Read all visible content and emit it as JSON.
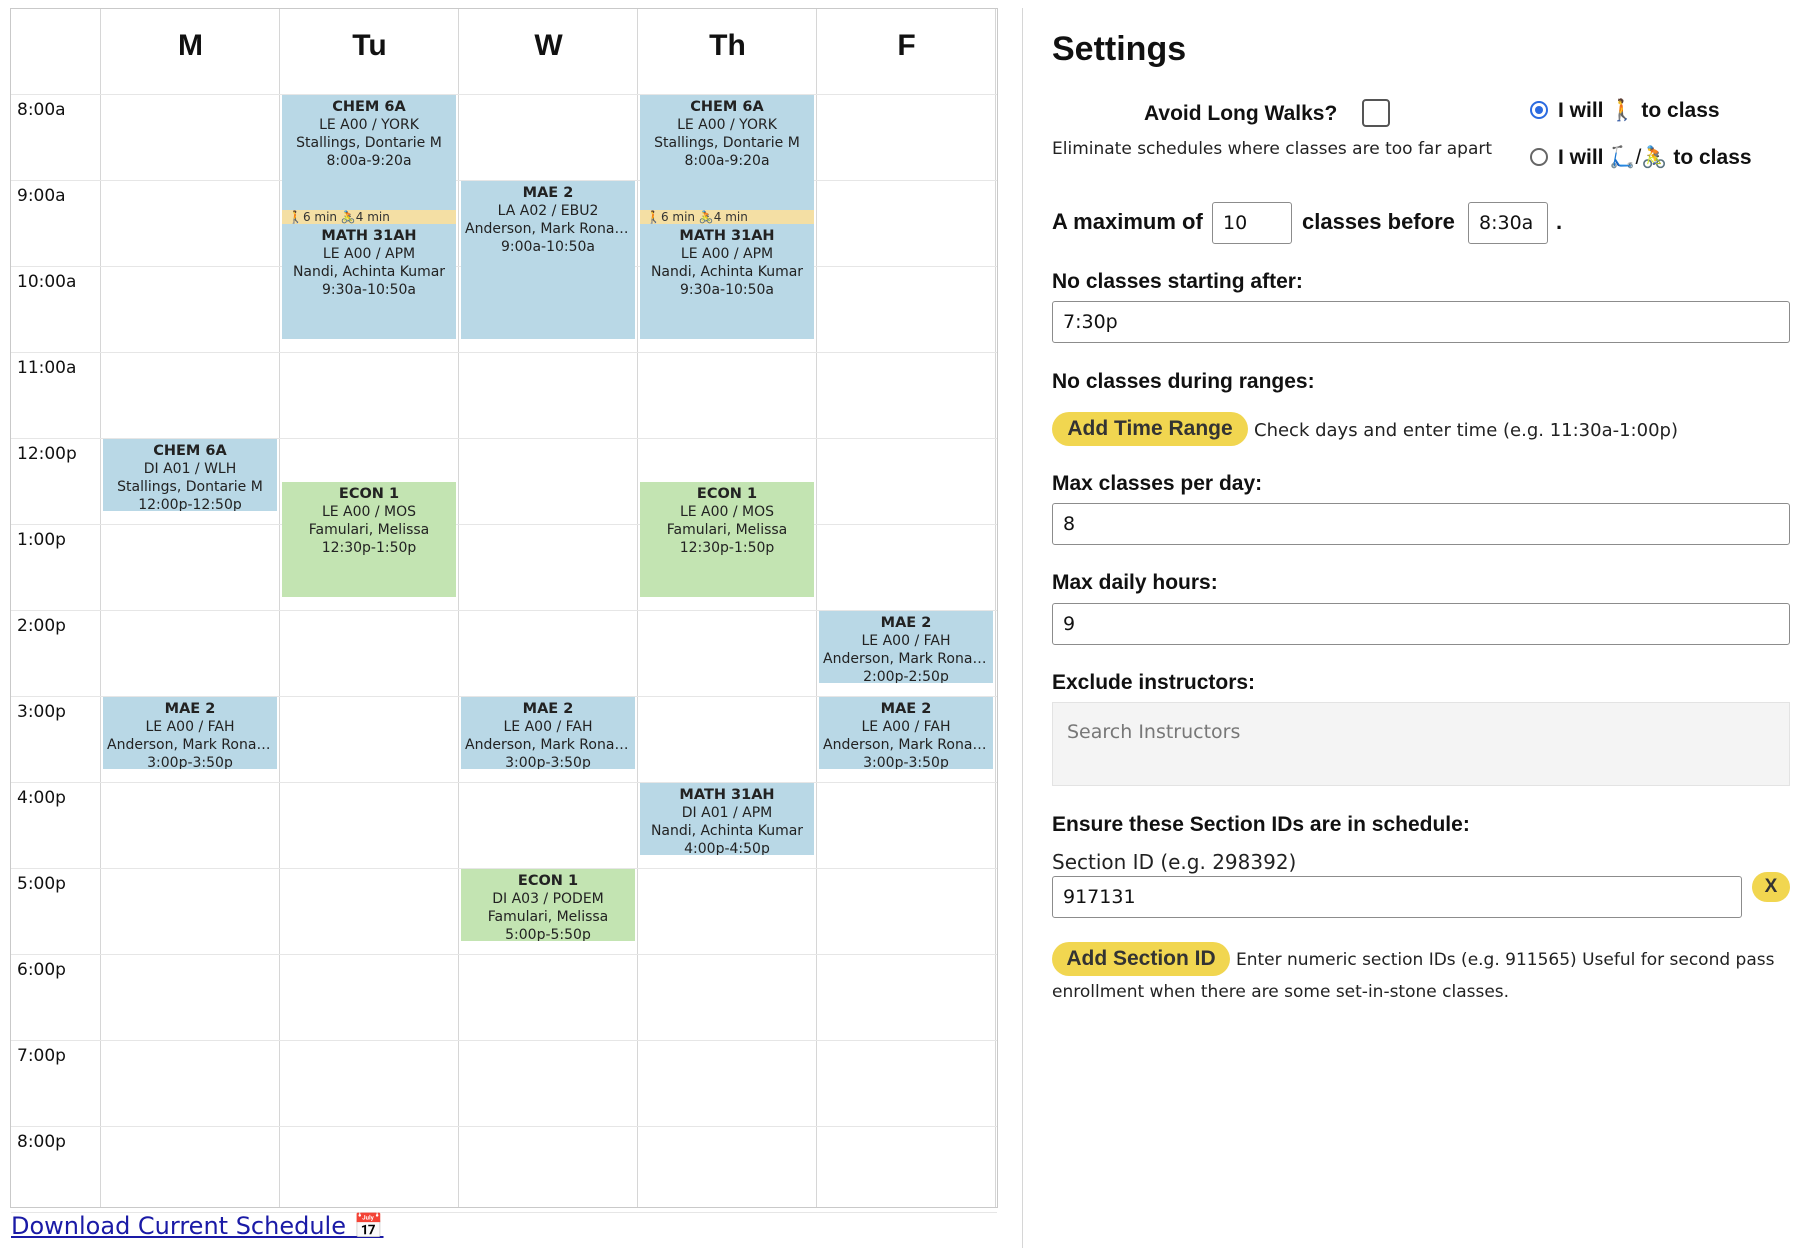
{
  "calendar": {
    "days": [
      "M",
      "Tu",
      "W",
      "Th",
      "F"
    ],
    "times": [
      "8:00a",
      "9:00a",
      "10:00a",
      "11:00a",
      "12:00p",
      "1:00p",
      "2:00p",
      "3:00p",
      "4:00p",
      "5:00p",
      "6:00p",
      "7:00p",
      "8:00p"
    ],
    "events": [
      {
        "day": 1,
        "start": 0,
        "end": 1.34,
        "color": "blue",
        "title": "CHEM 6A",
        "section": "LE A00 / YORK",
        "instructor": "Stallings, Dontarie M",
        "time": "8:00a-9:20a"
      },
      {
        "day": 1,
        "start": 1.5,
        "end": 2.84,
        "color": "blue",
        "title": "MATH 31AH",
        "section": "LE A00 / APM",
        "instructor": "Nandi, Achinta Kumar",
        "time": "9:30a-10:50a"
      },
      {
        "day": 3,
        "start": 0,
        "end": 1.34,
        "color": "blue",
        "title": "CHEM 6A",
        "section": "LE A00 / YORK",
        "instructor": "Stallings, Dontarie M",
        "time": "8:00a-9:20a"
      },
      {
        "day": 3,
        "start": 1.5,
        "end": 2.84,
        "color": "blue",
        "title": "MATH 31AH",
        "section": "LE A00 / APM",
        "instructor": "Nandi, Achinta Kumar",
        "time": "9:30a-10:50a"
      },
      {
        "day": 2,
        "start": 1,
        "end": 2.84,
        "color": "blue",
        "title": "MAE 2",
        "section": "LA A02 / EBU2",
        "instructor": "Anderson, Mark Ronal...",
        "time": "9:00a-10:50a"
      },
      {
        "day": 0,
        "start": 4,
        "end": 4.84,
        "color": "blue",
        "title": "CHEM 6A",
        "section": "DI A01 / WLH",
        "instructor": "Stallings, Dontarie M",
        "time": "12:00p-12:50p"
      },
      {
        "day": 1,
        "start": 4.5,
        "end": 5.84,
        "color": "green",
        "title": "ECON 1",
        "section": "LE A00 / MOS",
        "instructor": "Famulari, Melissa",
        "time": "12:30p-1:50p"
      },
      {
        "day": 3,
        "start": 4.5,
        "end": 5.84,
        "color": "green",
        "title": "ECON 1",
        "section": "LE A00 / MOS",
        "instructor": "Famulari, Melissa",
        "time": "12:30p-1:50p"
      },
      {
        "day": 4,
        "start": 6,
        "end": 6.84,
        "color": "blue",
        "title": "MAE 2",
        "section": "LE A00 / FAH",
        "instructor": "Anderson, Mark Ronal...",
        "time": "2:00p-2:50p"
      },
      {
        "day": 0,
        "start": 7,
        "end": 7.84,
        "color": "blue",
        "title": "MAE 2",
        "section": "LE A00 / FAH",
        "instructor": "Anderson, Mark Ronal...",
        "time": "3:00p-3:50p"
      },
      {
        "day": 2,
        "start": 7,
        "end": 7.84,
        "color": "blue",
        "title": "MAE 2",
        "section": "LE A00 / FAH",
        "instructor": "Anderson, Mark Ronal...",
        "time": "3:00p-3:50p"
      },
      {
        "day": 4,
        "start": 7,
        "end": 7.84,
        "color": "blue",
        "title": "MAE 2",
        "section": "LE A00 / FAH",
        "instructor": "Anderson, Mark Ronal...",
        "time": "3:00p-3:50p"
      },
      {
        "day": 3,
        "start": 8,
        "end": 8.84,
        "color": "blue",
        "title": "MATH 31AH",
        "section": "DI A01 / APM",
        "instructor": "Nandi, Achinta Kumar",
        "time": "4:00p-4:50p"
      },
      {
        "day": 2,
        "start": 9,
        "end": 9.84,
        "color": "green",
        "title": "ECON 1",
        "section": "DI A03 / PODEM",
        "instructor": "Famulari, Melissa",
        "time": "5:00p-5:50p"
      }
    ],
    "walk_bars": [
      {
        "day": 1,
        "start": 1.34,
        "text": "🚶6 min   🚴4 min"
      },
      {
        "day": 3,
        "start": 1.34,
        "text": "🚶6 min   🚴4 min"
      }
    ],
    "colors": {
      "blue": "#b9d8e6",
      "green": "#c3e4b2",
      "walk": "#f4dfa4"
    }
  },
  "download_link": "Download Current Schedule 📅",
  "settings": {
    "title": "Settings",
    "avoid_long_walks": {
      "label": "Avoid Long Walks?",
      "checked": false,
      "description": "Eliminate schedules where classes are too far apart"
    },
    "travel_mode": {
      "options": [
        {
          "prefix": "I will",
          "icons": "🚶",
          "suffix": "to class",
          "checked": true
        },
        {
          "prefix": "I will",
          "icons": "🛴/🚴",
          "suffix": "to class",
          "checked": false
        }
      ]
    },
    "max_before": {
      "prefix": "A maximum of",
      "count": "10",
      "middle": "classes before",
      "time": "8:30a",
      "suffix": "."
    },
    "no_classes_after": {
      "label": "No classes starting after:",
      "value": "7:30p"
    },
    "no_classes_ranges": {
      "label": "No classes during ranges:",
      "button": "Add Time Range",
      "hint": "Check days and enter time (e.g. 11:30a-1:00p)"
    },
    "max_per_day": {
      "label": "Max classes per day:",
      "value": "8"
    },
    "max_daily_hours": {
      "label": "Max daily hours:",
      "value": "9"
    },
    "exclude_instructors": {
      "label": "Exclude instructors:",
      "placeholder": "Search Instructors"
    },
    "section_ids": {
      "label": "Ensure these Section IDs are in schedule:",
      "field_label": "Section ID (e.g. 298392)",
      "value": "917131",
      "remove_button": "X",
      "add_button": "Add Section ID",
      "hint_line1": "Enter numeric section IDs (e.g. 911565) Useful for second pass",
      "hint_line2": "enrollment when there are some set-in-stone classes."
    }
  }
}
